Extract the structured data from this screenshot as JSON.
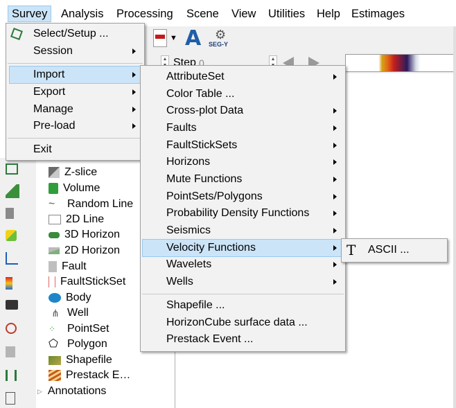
{
  "menubar": {
    "items": [
      "Survey",
      "Analysis",
      "Processing",
      "Scene",
      "View",
      "Utilities",
      "Help",
      "Estimages"
    ]
  },
  "survey_menu": {
    "items": [
      "Select/Setup ...",
      "Session",
      "Import",
      "Export",
      "Manage",
      "Pre-load",
      "Exit"
    ]
  },
  "import_menu": {
    "items": [
      "AttributeSet",
      "Color Table ...",
      "Cross-plot Data",
      "Faults",
      "FaultStickSets",
      "Horizons",
      "Mute Functions",
      "PointSets/Polygons",
      "Probability Density Functions",
      "Seismics",
      "Velocity Functions",
      "Wavelets",
      "Wells",
      "Shapefile ...",
      "HorizonCube surface data ...",
      "Prestack Event ..."
    ]
  },
  "velocity_menu": {
    "items": [
      "ASCII ..."
    ]
  },
  "toolbar": {
    "logo_letter": "A",
    "segy_label": "SEG-Y"
  },
  "stepbar": {
    "step_label": "Step",
    "step_value": "0"
  },
  "tree": {
    "items": [
      "Z-slice",
      "Volume",
      "Random Line",
      "2D Line",
      "3D Horizon",
      "2D Horizon",
      "Fault",
      "FaultStickSet",
      "Body",
      "Well",
      "PointSet",
      "Polygon",
      "Shapefile",
      "Prestack E…",
      "Annotations"
    ]
  },
  "colors": {
    "highlight": "#cce4f7",
    "highlight_border": "#99c9ef",
    "menu_bg": "#f2f2f2"
  }
}
